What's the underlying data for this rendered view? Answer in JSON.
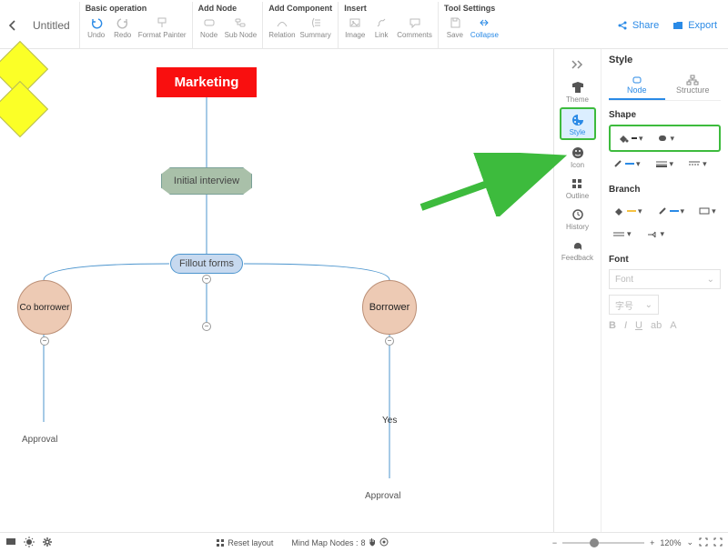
{
  "header": {
    "doc_title": "Untitled",
    "groups": {
      "basic": {
        "title": "Basic operation",
        "undo": "Undo",
        "redo": "Redo",
        "format": "Format Painter"
      },
      "addnode": {
        "title": "Add Node",
        "node": "Node",
        "subnode": "Sub Node"
      },
      "addcomp": {
        "title": "Add Component",
        "relation": "Relation",
        "summary": "Summary"
      },
      "insert": {
        "title": "Insert",
        "image": "Image",
        "link": "Link",
        "comments": "Comments"
      },
      "toolset": {
        "title": "Tool Settings",
        "save": "Save",
        "collapse": "Collapse"
      }
    },
    "share": "Share",
    "export": "Export"
  },
  "sidebar": {
    "theme": "Theme",
    "style": "Style",
    "icon": "Icon",
    "outline": "Outline",
    "history": "History",
    "feedback": "Feedback"
  },
  "panel": {
    "title": "Style",
    "tab_node": "Node",
    "tab_structure": "Structure",
    "shape": "Shape",
    "branch": "Branch",
    "font": "Font",
    "font_placeholder": "Font",
    "size_placeholder": "字号"
  },
  "bottom": {
    "reset": "Reset layout",
    "nodes_label": "Mind Map Nodes :",
    "nodes_count": "8",
    "zoom": "120%"
  },
  "nodes": {
    "marketing": "Marketing",
    "interview": "Initial interview",
    "forms": "Fillout forms",
    "cobor": "Co borrower",
    "bor": "Borrower",
    "approval": "Approval",
    "yes": "Yes"
  }
}
